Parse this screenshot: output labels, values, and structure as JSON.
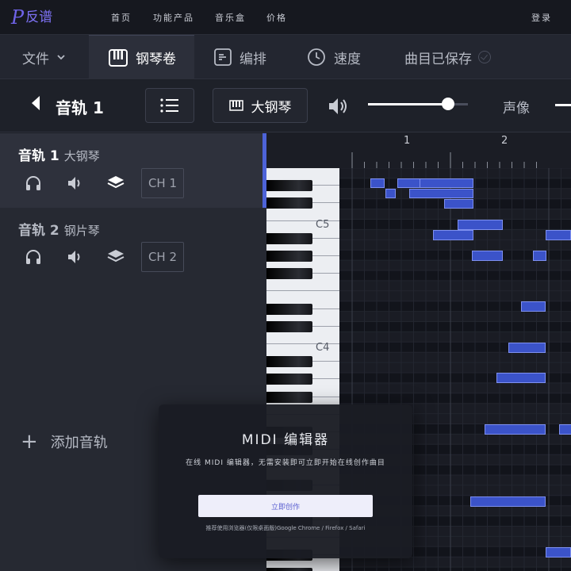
{
  "brand": {
    "mark": "P",
    "name": "反谱"
  },
  "nav": {
    "links": [
      "首页",
      "功能产品",
      "音乐盒",
      "价格"
    ],
    "login": "登录"
  },
  "tabs": {
    "file": "文件",
    "piano_roll": "钢琴卷",
    "arrange": "编排",
    "tempo": "速度",
    "saved": "曲目已保存"
  },
  "toolbar": {
    "track_name": "音轨 1",
    "instrument": "大钢琴",
    "volume": 0.8,
    "pan_label": "声像"
  },
  "tracks": [
    {
      "title": "音轨 1",
      "instrument": "大钢琴",
      "channel": "CH 1",
      "selected": true
    },
    {
      "title": "音轨 2",
      "instrument": "钢片琴",
      "channel": "CH 2",
      "selected": false
    }
  ],
  "add_track": "添加音轨",
  "roll": {
    "bars": [
      "1",
      "2"
    ],
    "octave_labels": [
      "C5",
      "C4"
    ]
  },
  "modal": {
    "title": "MIDI 编辑器",
    "subtitle": "在线 MIDI 编辑器，无需安装即可立即开始在线创作曲目",
    "button": "立即创作",
    "note": "推荐使用浏览器(仅限桌面版)Google Chrome / Firefox / Safari"
  },
  "colors": {
    "accent": "#4d63d8",
    "note": "#3b53c9",
    "brand": "#6f63e8"
  }
}
